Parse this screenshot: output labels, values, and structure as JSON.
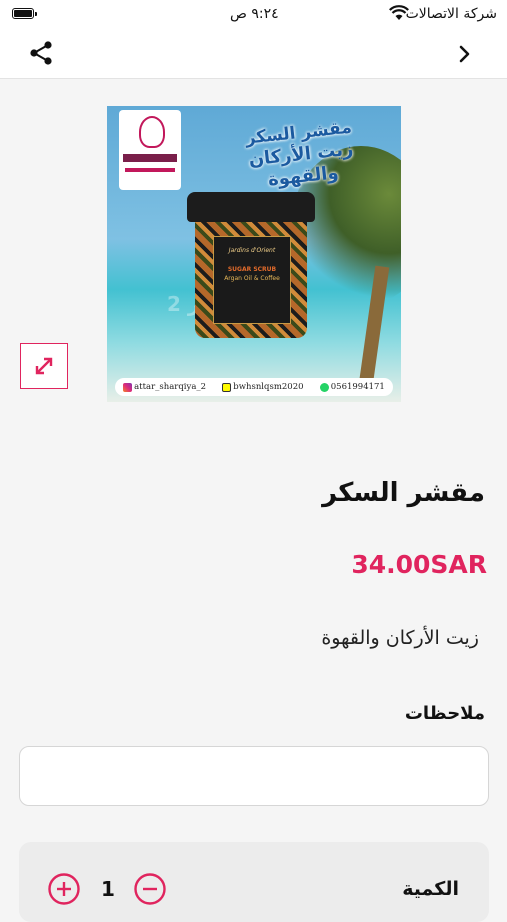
{
  "status_bar": {
    "carrier": "شركة الاتصالات",
    "time": "٩:٢٤ ص"
  },
  "nav": {
    "share_icon": "share-icon",
    "back_icon": "chevron-right-icon"
  },
  "product_image": {
    "title_line1": "مقشر السكر",
    "title_line2": "زيت الأركان والقهوة",
    "jar_brand": "Jardins d'Orient",
    "jar_product": "SUGAR SCRUB",
    "jar_sub": "Argan Oil & Coffee",
    "watermark": "2 عطار",
    "contacts": {
      "instagram": "attar_sharqiya_2",
      "snapchat": "bwhsnlqsm2020",
      "phone": "0561994171"
    }
  },
  "product": {
    "title": "مقشر السكر",
    "price": "34.00SAR",
    "description": "زيت الأركان والقهوة",
    "price_color": "#e0245e"
  },
  "notes": {
    "label": "ملاحظات",
    "value": "",
    "placeholder": ""
  },
  "quantity": {
    "label": "الكمية",
    "value": "1"
  }
}
